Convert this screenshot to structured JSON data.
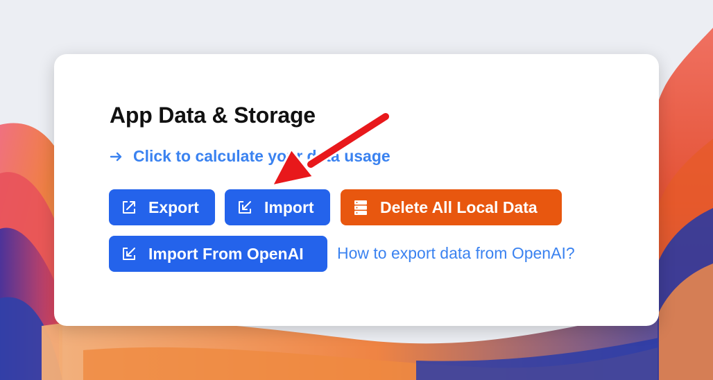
{
  "section": {
    "title": "App Data & Storage",
    "calculate_link": "Click to calculate your data usage",
    "calculate_icon": "arrow-right-icon"
  },
  "buttons": {
    "export": {
      "label": "Export",
      "icon": "external-link-icon"
    },
    "import": {
      "label": "Import",
      "icon": "external-link-icon"
    },
    "delete": {
      "label": "Delete All Local Data",
      "icon": "database-icon"
    },
    "import_openai": {
      "label": "Import From OpenAI",
      "icon": "external-link-icon"
    }
  },
  "help_link": "How to export data from OpenAI?",
  "colors": {
    "primary_button": "#2463eb",
    "danger_button": "#e8570f",
    "link": "#3a82f0",
    "annotation_arrow": "#e8181b"
  }
}
